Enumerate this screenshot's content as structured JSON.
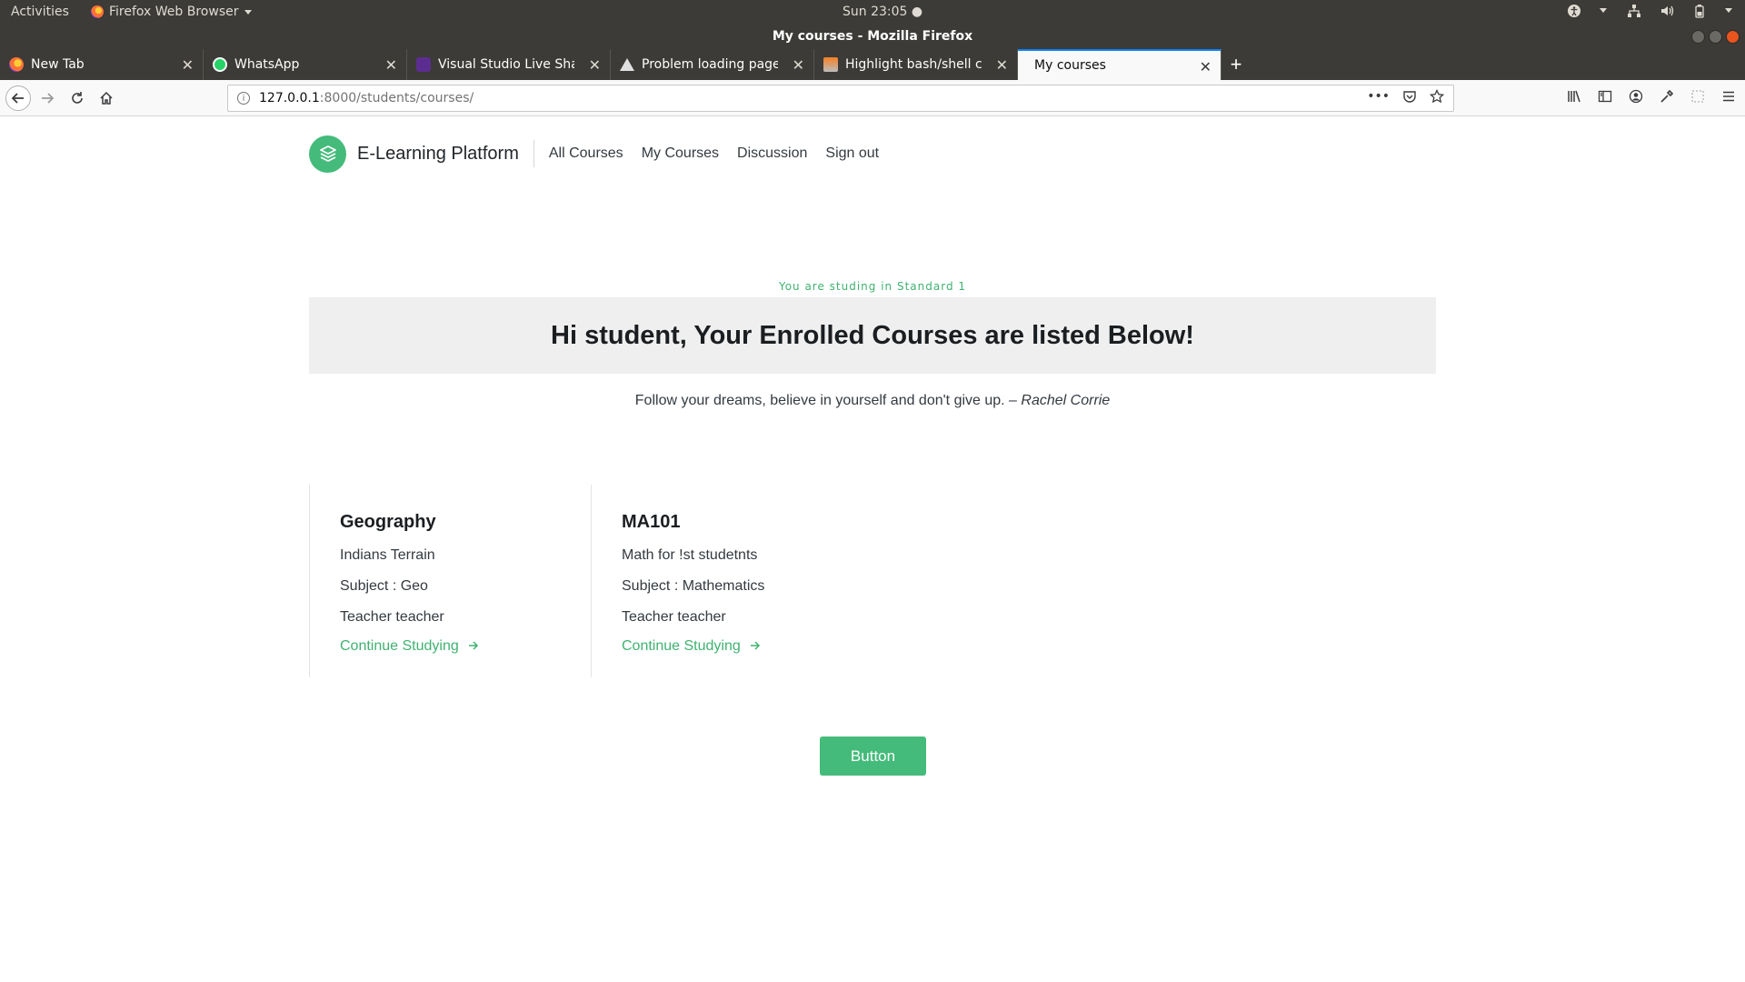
{
  "system_panel": {
    "activities": "Activities",
    "app_menu": "Firefox Web Browser",
    "clock": "Sun 23:05 ●"
  },
  "window": {
    "title": "My courses - Mozilla Firefox"
  },
  "tabs": [
    {
      "label": "New Tab",
      "icon": "firefox-icon"
    },
    {
      "label": "WhatsApp",
      "icon": "whatsapp-icon"
    },
    {
      "label": "Visual Studio Live Share",
      "icon": "visual-studio-icon"
    },
    {
      "label": "Problem loading page",
      "icon": "warning-icon"
    },
    {
      "label": "Highlight bash/shell code",
      "icon": "stackoverflow-icon"
    },
    {
      "label": "My courses",
      "icon": "",
      "active": true
    }
  ],
  "address_bar": {
    "host": "127.0.0.1",
    "path": ":8000/students/courses/"
  },
  "site": {
    "brand": "E-Learning Platform",
    "nav": [
      "All Courses",
      "My Courses",
      "Discussion",
      "Sign out"
    ],
    "accent_color": "#44bb7a"
  },
  "main": {
    "standard_note": "You are studing in Standard 1",
    "heading": "Hi student, Your Enrolled Courses are listed Below!",
    "quote_text": "Follow your dreams, believe in yourself and don't give up. –",
    "quote_author": "Rachel Corrie",
    "button_label": "Button"
  },
  "courses": [
    {
      "title": "Geography",
      "description": "Indians Terrain",
      "subject": "Subject : Geo",
      "teacher": "Teacher teacher",
      "link": "Continue Studying"
    },
    {
      "title": "MA101",
      "description": "Math for !st studetnts",
      "subject": "Subject : Mathematics",
      "teacher": "Teacher teacher",
      "link": "Continue Studying"
    }
  ]
}
